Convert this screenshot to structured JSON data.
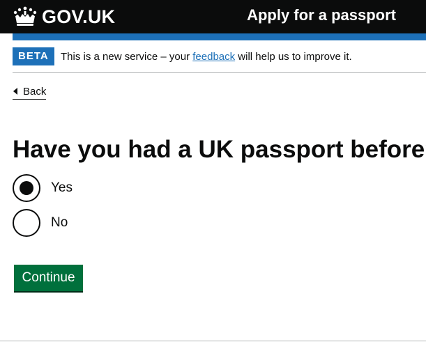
{
  "header": {
    "logo_text": "GOV.UK",
    "service_name": "Apply for a passport",
    "logo_icon": "crown-icon"
  },
  "phase_banner": {
    "tag": "BETA",
    "text_before": "This is a new service – your ",
    "link_text": "feedback",
    "text_after": " will help us to improve it."
  },
  "back_link": {
    "label": "Back",
    "icon": "back-arrow-icon"
  },
  "question": {
    "title": "Have you had a UK passport before?",
    "options": [
      {
        "label": "Yes",
        "selected": true
      },
      {
        "label": "No",
        "selected": false
      }
    ]
  },
  "actions": {
    "continue_label": "Continue"
  },
  "colors": {
    "header_bg": "#0b0c0c",
    "brand_blue": "#1d70b8",
    "button_green": "#00703c",
    "text": "#0b0c0c"
  }
}
